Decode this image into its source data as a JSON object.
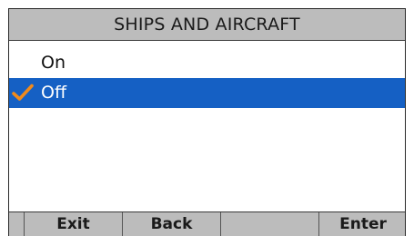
{
  "header": {
    "title": "SHIPS AND AIRCRAFT"
  },
  "options": [
    {
      "label": "On",
      "selected": false
    },
    {
      "label": "Off",
      "selected": true,
      "icon": "check-icon"
    }
  ],
  "softkeys": [
    {
      "label": ""
    },
    {
      "label": "Exit"
    },
    {
      "label": "Back"
    },
    {
      "label": ""
    },
    {
      "label": "Enter"
    }
  ],
  "colors": {
    "title_bar": "#bcbcbc",
    "selection": "#1560c4",
    "check": "#f08a1c",
    "softkey_bar": "#bcbcbc"
  }
}
